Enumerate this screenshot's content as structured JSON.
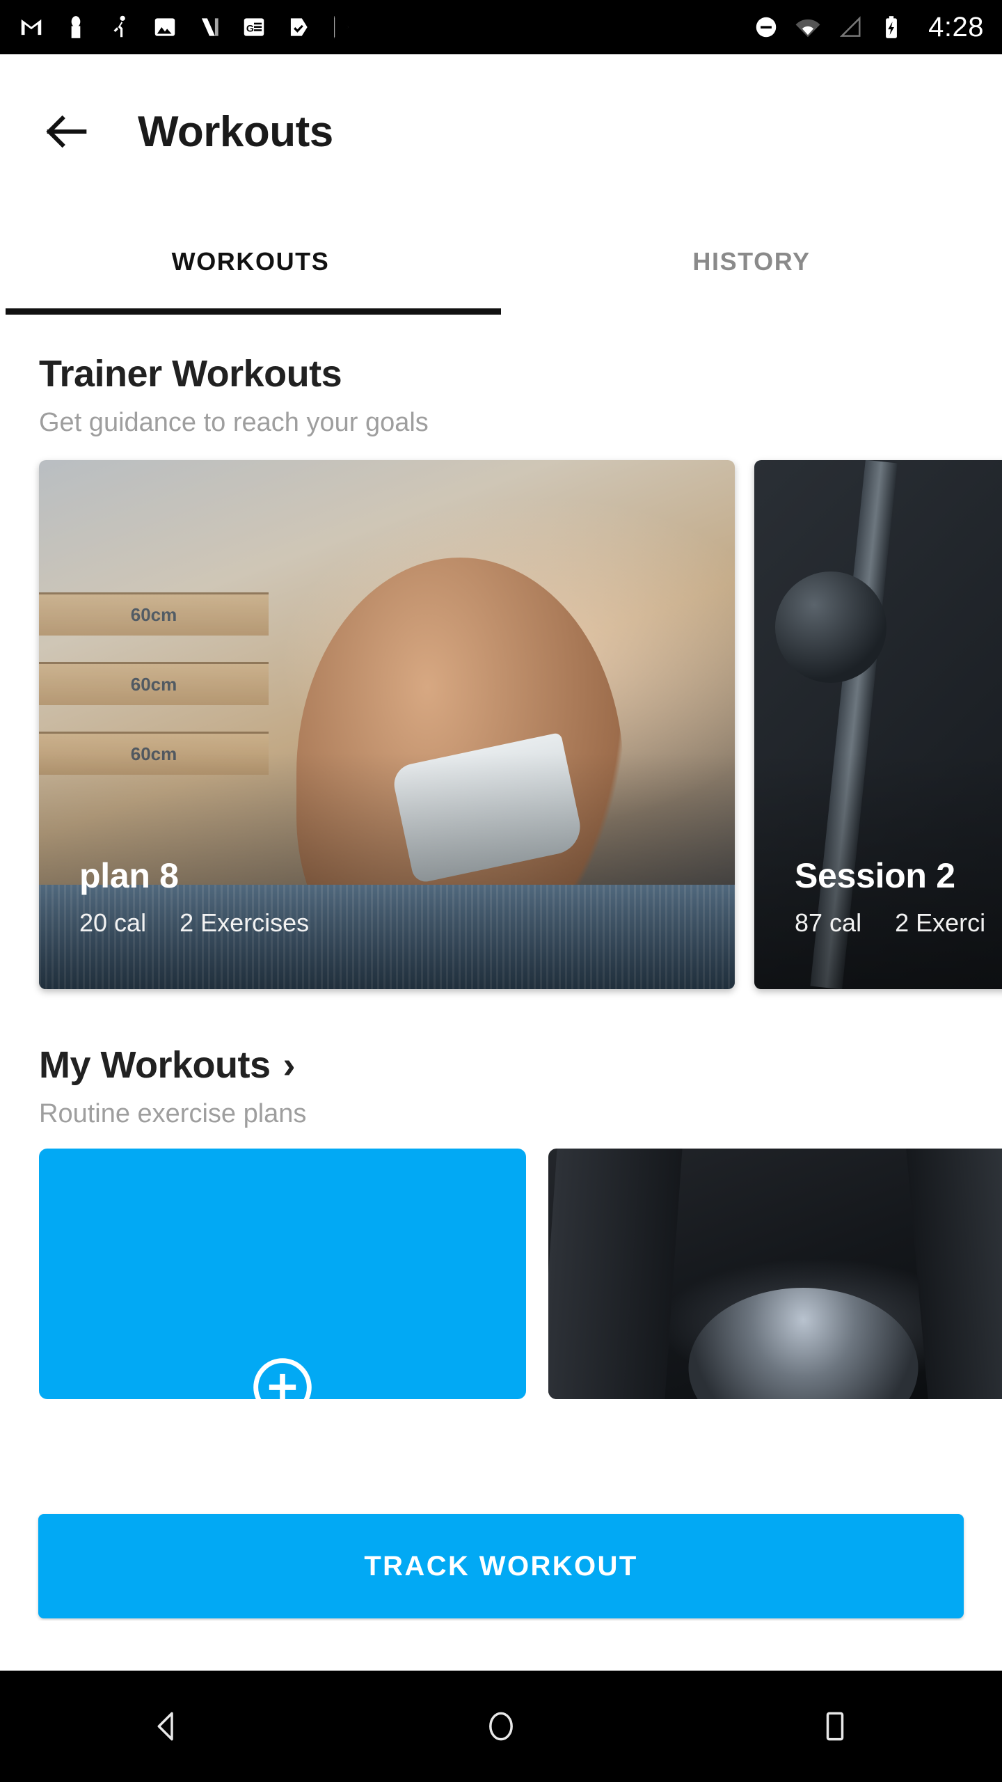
{
  "status_bar": {
    "icons": [
      "gmail-icon",
      "person-icon",
      "fitness-icon",
      "photos-icon",
      "news-icon",
      "google-news-icon",
      "tasks-icon",
      "play-store-icon"
    ],
    "right_icons": [
      "do-not-disturb-icon",
      "wifi-icon",
      "cell-signal-icon",
      "battery-charging-icon"
    ],
    "time": "4:28"
  },
  "app_bar": {
    "back_icon": "back-arrow-icon",
    "title": "Workouts"
  },
  "tabs": [
    {
      "label": "WORKOUTS",
      "active": true
    },
    {
      "label": "HISTORY",
      "active": false
    }
  ],
  "trainer_section": {
    "title": "Trainer Workouts",
    "subtitle": "Get guidance to reach your goals",
    "cards": [
      {
        "title": "plan 8",
        "calories": "20 cal",
        "exercises": "2 Exercises",
        "image": "woman-doing-situps-in-gym"
      },
      {
        "title": "Session 2",
        "calories": "87 cal",
        "exercises": "2 Exerci",
        "image": "person-bench-pressing-barbell"
      }
    ]
  },
  "my_section": {
    "title": "My Workouts",
    "chevron": "›",
    "subtitle": "Routine exercise plans",
    "cards": [
      {
        "type": "add",
        "icon": "add-circle-icon"
      },
      {
        "type": "photo",
        "image": "kettlebell-in-dark-gym"
      }
    ]
  },
  "track_button": {
    "label": "TRACK WORKOUT"
  },
  "nav_bar": {
    "buttons": [
      "nav-back-icon",
      "nav-home-icon",
      "nav-recents-icon"
    ]
  },
  "colors": {
    "accent": "#02A9F4",
    "tab_active": "#111111",
    "tab_inactive": "#8a8a8a",
    "title": "#212121",
    "subtitle": "#9e9e9e",
    "status_bar_bg": "#000000",
    "nav_bar_bg": "#000000"
  },
  "boxes": [
    "60cm",
    "60cm",
    "60cm"
  ]
}
